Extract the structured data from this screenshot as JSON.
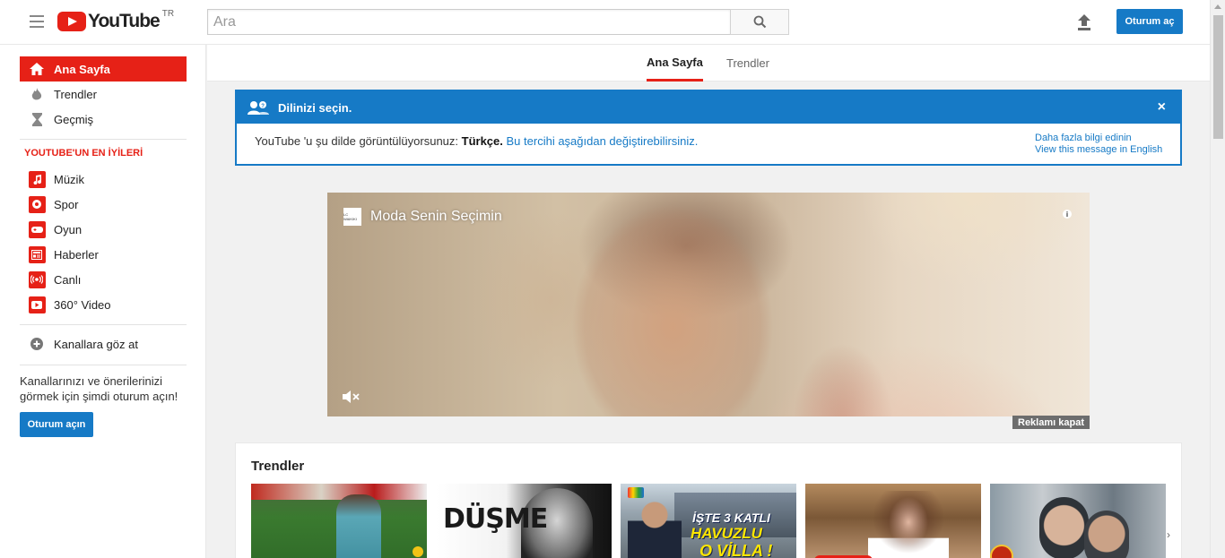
{
  "header": {
    "logo_text": "YouTube",
    "country_code": "TR",
    "search_placeholder": "Ara",
    "search_value": "",
    "signin_label": "Oturum aç"
  },
  "sidebar": {
    "main_items": [
      {
        "label": "Ana Sayfa",
        "icon": "home-icon",
        "active": true
      },
      {
        "label": "Trendler",
        "icon": "flame-icon",
        "active": false
      },
      {
        "label": "Geçmiş",
        "icon": "hourglass-icon",
        "active": false
      }
    ],
    "section_heading": "YOUTUBE'UN EN İYİLERİ",
    "category_items": [
      {
        "label": "Müzik",
        "icon": "music-icon"
      },
      {
        "label": "Spor",
        "icon": "sports-icon"
      },
      {
        "label": "Oyun",
        "icon": "gaming-icon"
      },
      {
        "label": "Haberler",
        "icon": "news-icon"
      },
      {
        "label": "Canlı",
        "icon": "live-icon"
      },
      {
        "label": "360° Video",
        "icon": "video-360-icon"
      }
    ],
    "browse_channels_label": "Kanallara göz at",
    "signin_prompt": "Kanallarınızı ve önerilerinizi görmek için şimdi oturum açın!",
    "signin_button": "Oturum açın"
  },
  "tabs": [
    {
      "label": "Ana Sayfa",
      "active": true
    },
    {
      "label": "Trendler",
      "active": false
    }
  ],
  "language_banner": {
    "title": "Dilinizi seçin.",
    "message_prefix": "YouTube 'u şu dilde görüntülüyorsunuz:",
    "language": "Türkçe.",
    "change_link": "Bu tercihi aşağıdan değiştirebilirsiniz.",
    "learn_more": "Daha fazla bilgi edinin",
    "english_link": "View this message in English",
    "close_glyph": "×"
  },
  "ad": {
    "title": "Moda Senin Seçimin",
    "logo_text": "LC WAIKIKI",
    "info_glyph": "i",
    "close_label": "Reklamı kapat"
  },
  "trending": {
    "title": "Trendler",
    "next_glyph": "›",
    "thumbnails": [
      {
        "name": "thumb-football"
      },
      {
        "name": "thumb-dusme",
        "text": "DÜŞME"
      },
      {
        "name": "thumb-villa",
        "text_line1": "İŞTE 3 KATLI",
        "text_line2": "HAVUZLU",
        "text_line3": "O VİLLA !"
      },
      {
        "name": "thumb-woman"
      },
      {
        "name": "thumb-two-men"
      }
    ]
  },
  "colors": {
    "brand_red": "#e62117",
    "accent_blue": "#167ac6"
  }
}
